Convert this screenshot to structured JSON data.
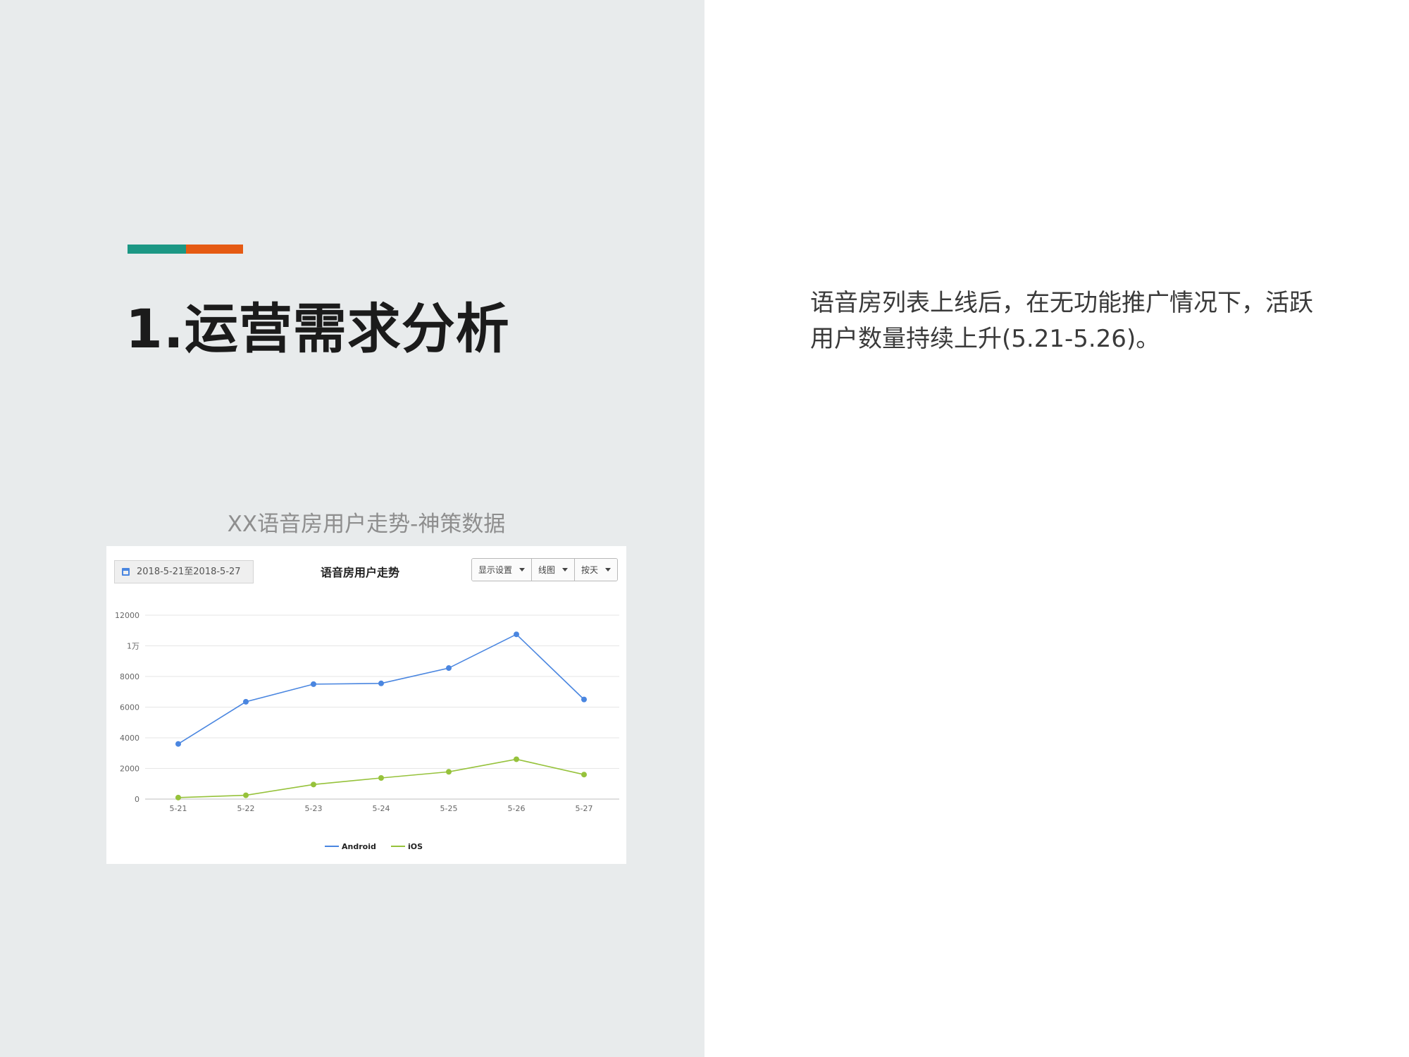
{
  "slide": {
    "title": "1.运营需求分析",
    "accent_colors": [
      "#1b9784",
      "#e55a13"
    ],
    "body_text": "语音房列表上线后，在无功能推广情况下，活跃用户数量持续上升(5.21-5.26)。",
    "chart_caption": "XX语音房用户走势-神策数据"
  },
  "chart_ui": {
    "date_range": "2018-5-21至2018-5-27",
    "controls": [
      {
        "label": "显示设置",
        "icon": "caret-down-icon"
      },
      {
        "label": "线图",
        "icon": "caret-down-icon"
      },
      {
        "label": "按天",
        "icon": "caret-down-icon"
      }
    ]
  },
  "chart_data": {
    "type": "line",
    "title": "语音房用户走势",
    "xlabel": "",
    "ylabel": "",
    "categories": [
      "5-21",
      "5-22",
      "5-23",
      "5-24",
      "5-25",
      "5-26",
      "5-27"
    ],
    "ylim": [
      0,
      12000
    ],
    "yticks": [
      0,
      2000,
      4000,
      6000,
      8000,
      10000,
      12000
    ],
    "ytick_labels": [
      "0",
      "2000",
      "4000",
      "6000",
      "8000",
      "1万",
      "12000"
    ],
    "grid": true,
    "legend_position": "bottom-center",
    "series": [
      {
        "name": "Android",
        "color": "#4a86e0",
        "values": [
          3600,
          6350,
          7500,
          7550,
          8550,
          10750,
          6500
        ]
      },
      {
        "name": "iOS",
        "color": "#96c23b",
        "values": [
          100,
          250,
          950,
          1380,
          1780,
          2600,
          1600
        ]
      }
    ]
  }
}
